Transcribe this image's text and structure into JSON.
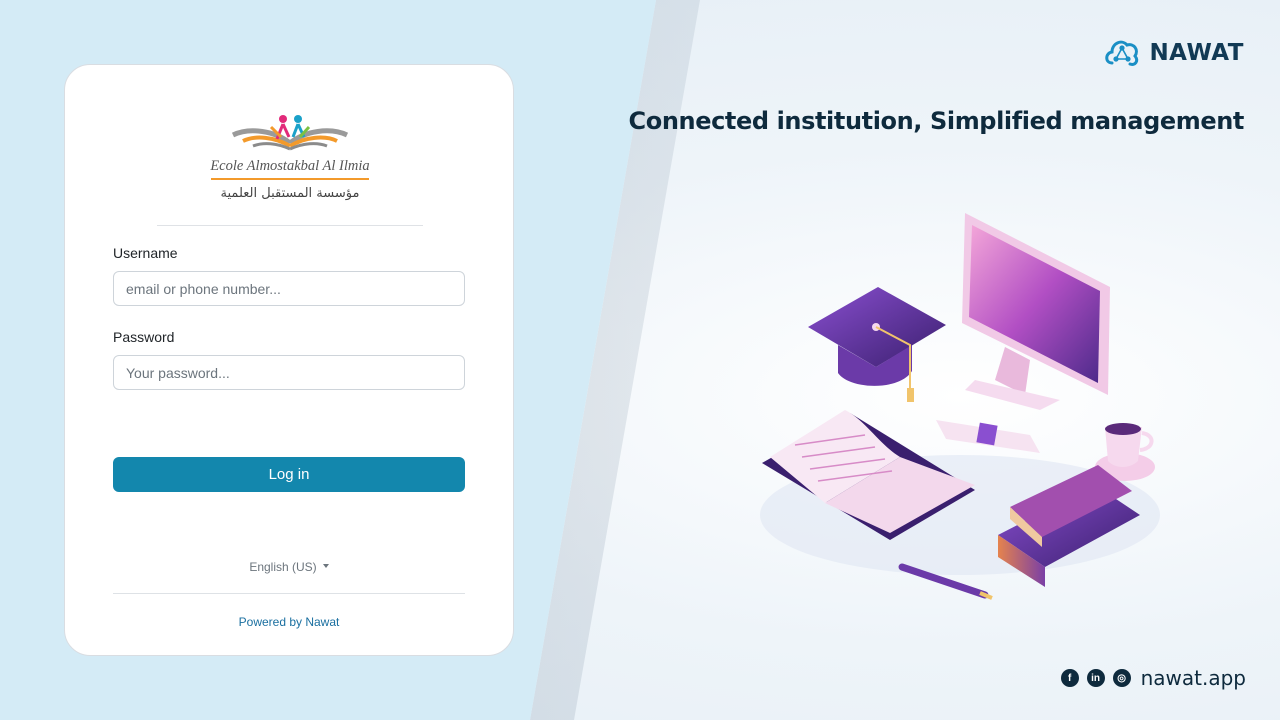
{
  "brand": {
    "name": "NAWAT",
    "icon": "nawat-logo-icon"
  },
  "headline": "Connected institution, Simplified management",
  "school": {
    "name_latin": "Ecole Almostakbal Al Ilmia",
    "name_arabic": "مؤسسة المستقبل العلمية"
  },
  "form": {
    "username_label": "Username",
    "username_placeholder": "email or phone number...",
    "username_value": "",
    "password_label": "Password",
    "password_placeholder": "Your password...",
    "password_value": "",
    "login_label": "Log in"
  },
  "language": {
    "selected": "English (US)"
  },
  "footer": {
    "powered_by": "Powered by Nawat"
  },
  "social": {
    "icons": [
      "facebook-icon",
      "linkedin-icon",
      "instagram-icon"
    ],
    "site": "nawat.app"
  },
  "colors": {
    "accent": "#1387ad",
    "left_panel": "#d4ebf6",
    "headline": "#0e2a3d",
    "link": "#1a6fa0"
  }
}
